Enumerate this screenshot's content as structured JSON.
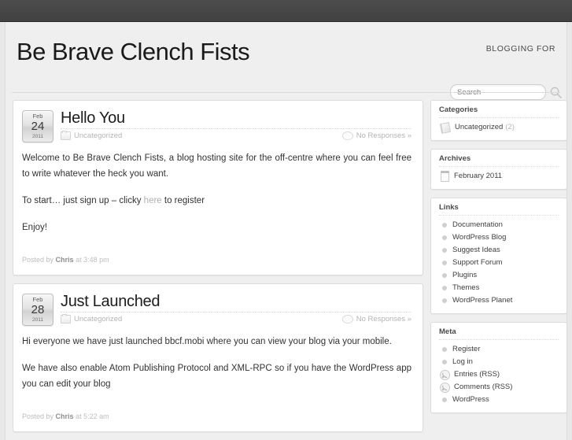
{
  "topbar": {
    "label": "admin-bar"
  },
  "header": {
    "site_title": "Be Brave Clench Fists",
    "tagline": "BLOGGING FOR",
    "search_placeholder": "Search",
    "search_value": "",
    "search_icon": "search-icon"
  },
  "posts": [
    {
      "date": {
        "month": "Feb",
        "day": "24",
        "year": "2011"
      },
      "title": "Hello You",
      "category": "Uncategorized",
      "responses": "No Responses »",
      "paragraphs": [
        "Welcome to Be Brave Clench Fists, a blog hosting site for the off-centre where you can feel free to write whatever the heck you want.",
        "To start… just sign up – clicky here to register",
        "Enjoy!"
      ],
      "link_text": "here",
      "footer_prefix": "Posted by",
      "author": "Chris",
      "footer_suffix": "at 3:48 pm"
    },
    {
      "date": {
        "month": "Feb",
        "day": "28",
        "year": "2011"
      },
      "title": "Just Launched",
      "category": "Uncategorized",
      "responses": "No Responses »",
      "paragraphs": [
        "Hi everyone we have just launched bbcf.mobi where you can view your blog via your mobile.",
        "We have also enable Atom Publishing Protocol and XML-RPC so if you have the WordPress app you can edit your blog"
      ],
      "footer_prefix": "Posted by",
      "author": "Chris",
      "footer_suffix": "at 5:22 am"
    }
  ],
  "sidebar": {
    "widgets": [
      {
        "title": "Categories",
        "items": [
          {
            "icon": "book-icon",
            "label": "Uncategorized",
            "count": "(2)"
          }
        ]
      },
      {
        "title": "Archives",
        "items": [
          {
            "icon": "cal-icon",
            "label": "February 2011",
            "count": ""
          }
        ]
      },
      {
        "title": "Links",
        "items": [
          {
            "icon": "bullet",
            "label": "Documentation",
            "count": ""
          },
          {
            "icon": "bullet",
            "label": "WordPress Blog",
            "count": ""
          },
          {
            "icon": "bullet",
            "label": "Suggest Ideas",
            "count": ""
          },
          {
            "icon": "bullet",
            "label": "Support Forum",
            "count": ""
          },
          {
            "icon": "bullet",
            "label": "Plugins",
            "count": ""
          },
          {
            "icon": "bullet",
            "label": "Themes",
            "count": ""
          },
          {
            "icon": "bullet",
            "label": "WordPress Planet",
            "count": ""
          }
        ]
      },
      {
        "title": "Meta",
        "items": [
          {
            "icon": "bullet",
            "label": "Register",
            "count": ""
          },
          {
            "icon": "bullet",
            "label": "Log in",
            "count": ""
          },
          {
            "icon": "rss-icon",
            "label": "Entries (RSS)",
            "count": ""
          },
          {
            "icon": "rss-icon",
            "label": "Comments (RSS)",
            "count": ""
          },
          {
            "icon": "bullet",
            "label": "WordPress",
            "count": ""
          }
        ]
      }
    ]
  },
  "colors": {
    "topbar": "#464646",
    "page_bg": "#efefef",
    "card_bg": "#ffffff",
    "border": "#dcdcdc",
    "text": "#323232",
    "muted": "#b4b4b4"
  }
}
